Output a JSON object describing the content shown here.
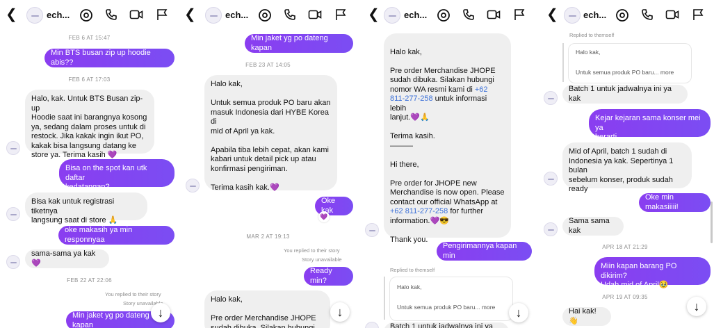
{
  "contact_name": "ech...",
  "colors": {
    "outgoing": "#7b3ff2",
    "incoming": "#efefef",
    "timestamp": "#8e8e8e"
  },
  "icons": [
    "chevron-left-icon",
    "profile-avatar",
    "link-icon",
    "phone-icon",
    "video-icon",
    "flag-icon",
    "arrow-down-icon"
  ],
  "panel1": {
    "ts1": "FEB 6 AT 15:47",
    "m1": "Min BTS busan zip up hoodie abis??",
    "ts2": "FEB 6 AT 17:03",
    "m2": "Halo, kak. Untuk BTS Busan zip-up\nHoodie saat ini barangnya kosong\nya, sedang dalam proses untuk di\nrestock. Jika kakak ingin ikut PO,\nkakak bisa langsung datang ke\nstore ya. Terima kasih 💜",
    "m3": "Bisa on the spot kan utk daftar\nkedatangan?",
    "m4": "Bisa kak untuk registrasi tiketnya\nlangsung saat di store 🙏",
    "m5": "oke makasih ya min responnyaa",
    "m6": "sama-sama ya kak 💜",
    "ts3": "FEB 22 AT 22:06",
    "reply_label": "You replied to their story",
    "story_unavailable": "Story unavailable",
    "m7": "Min jaket yg po dateng kapan"
  },
  "panel2": {
    "m1": "Min jaket yg po dateng kapan",
    "ts1": "FEB 23 AT 14:05",
    "m2": "Halo kak,\n\nUntuk semua produk PO baru akan\nmasuk Indonesia dari HYBE Korea di\nmid of April ya kak.\n\nApabila tiba lebih cepat, akan kami\nkabari untuk detail pick up atau\nkonfirmasi pengiriman.\n\nTerima kasih kak.💜",
    "m3": "Oke kak",
    "reaction": "💜",
    "ts2": "MAR 2 AT 19:13",
    "reply_label": "You replied to their story",
    "story_unavailable": "Story unavailable",
    "m4": "Ready min?",
    "m5": "Halo kak,\n\nPre order Merchandise JHOPE\nsudah dibuka. Silakan hubungi"
  },
  "panel3": {
    "m1_a": "Halo kak,\n\nPre order Merchandise JHOPE\nsudah dibuka. Silakan hubungi\nnomor WA resmi kami di ",
    "m1_link1": "+62\n811-277-258",
    "m1_b": " untuk informasi lebih\nlanjut.💜🙏\n\nTerima kasih.\n———\n\nHi there,\n\nPre order for JHOPE new\nMerchandise is now open. Please\ncontact our official WhatsApp at\n",
    "m1_link2": "+62 811-277-258",
    "m1_c": " for further\ninformation.💜😎\n\nThank you.",
    "m2": "Pengirimannya kapan min",
    "replied_label": "Replied to themself",
    "quote_a": "Halo kak,",
    "quote_b": "Untuk semua produk PO baru... more",
    "m3": "Batch 1 untuk jadwalnya ini ya kak"
  },
  "panel4": {
    "replied_label": "Replied to themself",
    "quote_a": "Halo kak,",
    "quote_b": "Untuk semua produk PO baru... more",
    "m1": "Batch 1 untuk jadwalnya ini ya kak",
    "m2": "Kejar kejaran sama konser mei ya\nberarti.....",
    "m3": "Mid of April, batch 1 sudah di\nIndonesia ya kak. Sepertinya 1 bulan\nsebelum konser, produk sudah\nready",
    "m4": "Oke min makasiiiii!",
    "m5": "Sama sama kak",
    "ts1": "APR 18 AT 21:29",
    "m6": "Miin kapan barang PO dikirim?\nUdah mid of April🥹",
    "ts2": "APR 19 AT 09:35",
    "m7": "Hai kak! 👋"
  }
}
